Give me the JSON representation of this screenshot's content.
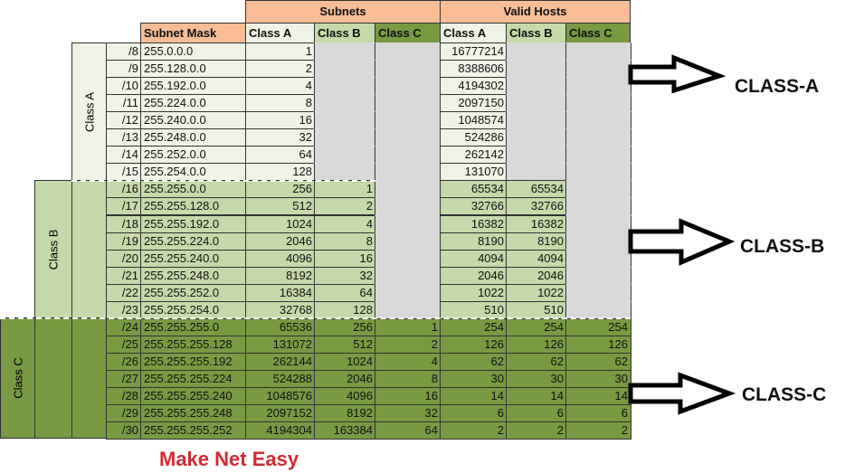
{
  "headers": {
    "subnet_mask": "Subnet Mask",
    "subnets": "Subnets",
    "valid_hosts": "Valid Hosts",
    "class_a": "Class A",
    "class_b": "Class B",
    "class_c": "Class C"
  },
  "group_labels": {
    "class_a": "Class A",
    "class_b": "Class B",
    "class_c": "Class C"
  },
  "rows": [
    [
      "/8",
      "255.0.0.0",
      "1",
      "",
      "",
      "16777214",
      "",
      ""
    ],
    [
      "/9",
      "255.128.0.0",
      "2",
      "",
      "",
      "8388606",
      "",
      ""
    ],
    [
      "/10",
      "255.192.0.0",
      "4",
      "",
      "",
      "4194302",
      "",
      ""
    ],
    [
      "/11",
      "255.224.0.0",
      "8",
      "",
      "",
      "2097150",
      "",
      ""
    ],
    [
      "/12",
      "255.240.0.0",
      "16",
      "",
      "",
      "1048574",
      "",
      ""
    ],
    [
      "/13",
      "255.248.0.0",
      "32",
      "",
      "",
      "524286",
      "",
      ""
    ],
    [
      "/14",
      "255.252.0.0",
      "64",
      "",
      "",
      "262142",
      "",
      ""
    ],
    [
      "/15",
      "255.254.0.0",
      "128",
      "",
      "",
      "131070",
      "",
      ""
    ],
    [
      "/16",
      "255.255.0.0",
      "256",
      "1",
      "",
      "65534",
      "65534",
      ""
    ],
    [
      "/17",
      "255.255.128.0",
      "512",
      "2",
      "",
      "32766",
      "32766",
      ""
    ],
    [
      "/18",
      "255.255.192.0",
      "1024",
      "4",
      "",
      "16382",
      "16382",
      ""
    ],
    [
      "/19",
      "255.255.224.0",
      "2046",
      "8",
      "",
      "8190",
      "8190",
      ""
    ],
    [
      "/20",
      "255.255.240.0",
      "4096",
      "16",
      "",
      "4094",
      "4094",
      ""
    ],
    [
      "/21",
      "255.255.248.0",
      "8192",
      "32",
      "",
      "2046",
      "2046",
      ""
    ],
    [
      "/22",
      "255.255.252.0",
      "16384",
      "64",
      "",
      "1022",
      "1022",
      ""
    ],
    [
      "/23",
      "255.255.254.0",
      "32768",
      "128",
      "",
      "510",
      "510",
      ""
    ],
    [
      "/24",
      "255.255.255.0",
      "65536",
      "256",
      "1",
      "254",
      "254",
      "254"
    ],
    [
      "/25",
      "255.255.255.128",
      "131072",
      "512",
      "2",
      "126",
      "126",
      "126"
    ],
    [
      "/26",
      "255.255.255.192",
      "262144",
      "1024",
      "4",
      "62",
      "62",
      "62"
    ],
    [
      "/27",
      "255.255.255.224",
      "524288",
      "2046",
      "8",
      "30",
      "30",
      "30"
    ],
    [
      "/28",
      "255.255.255.240",
      "1048576",
      "4096",
      "16",
      "14",
      "14",
      "14"
    ],
    [
      "/29",
      "255.255.255.248",
      "2097152",
      "8192",
      "32",
      "6",
      "6",
      "6"
    ],
    [
      "/30",
      "255.255.255.252",
      "4194304",
      "163384",
      "64",
      "2",
      "2",
      "2"
    ]
  ],
  "annotations": {
    "class_a": "CLASS-A",
    "class_b": "CLASS-B",
    "class_c": "CLASS-C"
  },
  "brand": "Make Net Easy",
  "colors": {
    "header": "#f8bd95",
    "class_a": "#eef3e6",
    "class_b": "#c6d9a8",
    "class_c": "#779a42",
    "empty": "#d9d9d9",
    "brand": "#d42a33"
  }
}
